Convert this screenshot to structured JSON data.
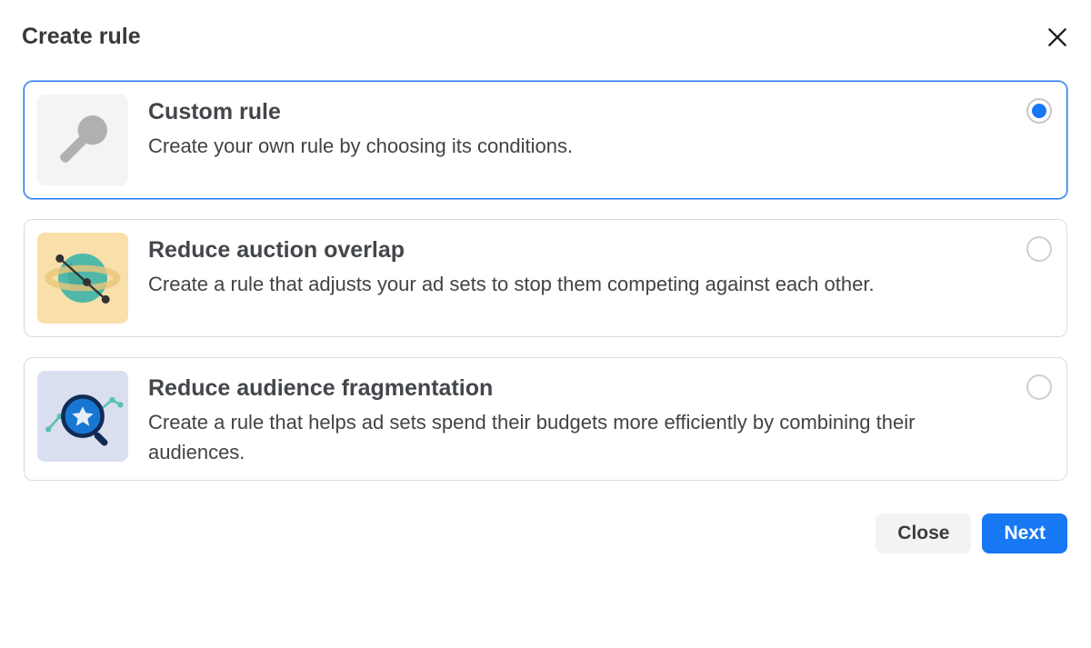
{
  "header": {
    "title": "Create rule"
  },
  "options": [
    {
      "id": "custom",
      "title": "Custom rule",
      "desc": "Create your own rule by choosing its conditions.",
      "selected": true
    },
    {
      "id": "overlap",
      "title": "Reduce auction overlap",
      "desc": "Create a rule that adjusts your ad sets to stop them competing against each other.",
      "selected": false
    },
    {
      "id": "fragmentation",
      "title": "Reduce audience fragmentation",
      "desc": "Create a rule that helps ad sets spend their budgets more efficiently by combining their audiences.",
      "selected": false
    }
  ],
  "footer": {
    "close": "Close",
    "next": "Next"
  }
}
